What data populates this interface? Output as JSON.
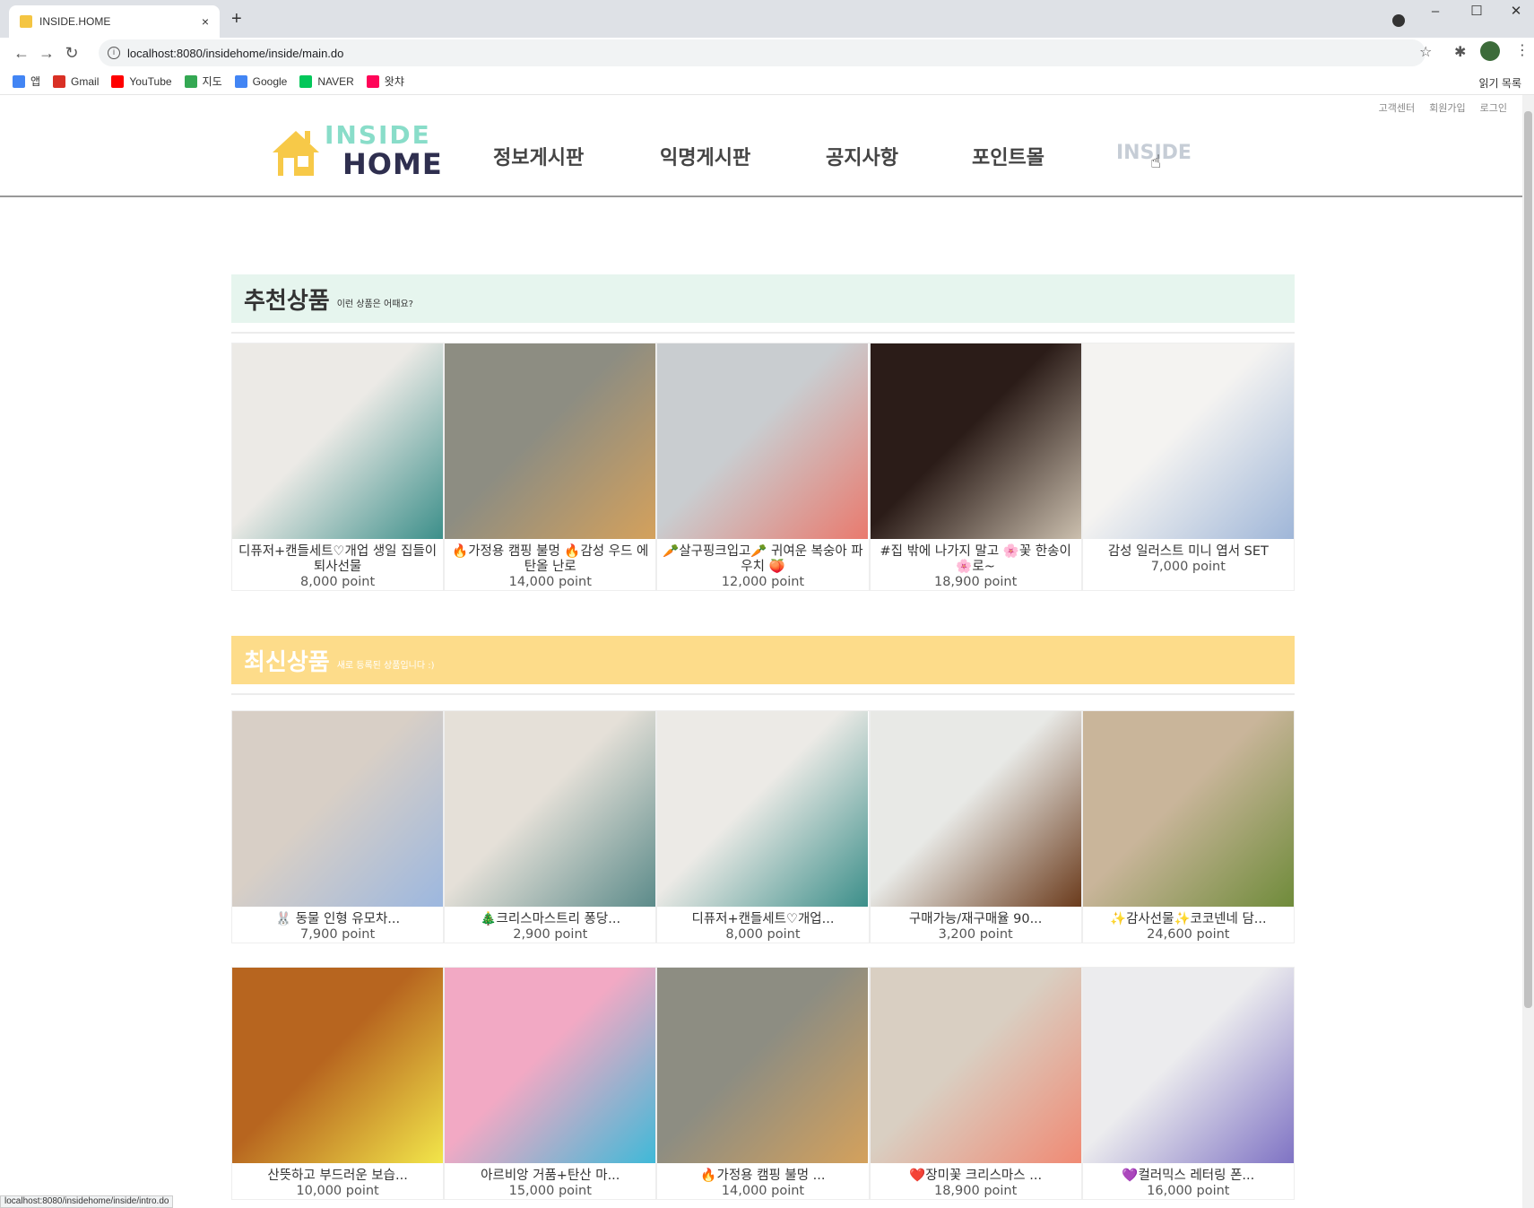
{
  "browser": {
    "tab_title": "INSIDE.HOME",
    "tab_close": "×",
    "new_tab": "+",
    "url": "localhost:8080/insidehome/inside/main.do",
    "window_controls": [
      "–",
      "☐",
      "✕"
    ],
    "bookmarks": [
      {
        "label": "앱",
        "icon": "apps-grid-icon",
        "color": "#4285f4"
      },
      {
        "label": "Gmail",
        "icon": "gmail-icon",
        "color": "#d93025"
      },
      {
        "label": "YouTube",
        "icon": "youtube-icon",
        "color": "#ff0000"
      },
      {
        "label": "지도",
        "icon": "maps-icon",
        "color": "#34a853"
      },
      {
        "label": "Google",
        "icon": "google-icon",
        "color": "#4285f4"
      },
      {
        "label": "NAVER",
        "icon": "naver-icon",
        "color": "#03c75a"
      },
      {
        "label": "왓챠",
        "icon": "watcha-icon",
        "color": "#ff0558"
      }
    ],
    "reading_list": "읽기 목록",
    "status_url": "localhost:8080/insidehome/inside/intro.do"
  },
  "header": {
    "top_links": [
      "고객센터",
      "회원가입",
      "로그인"
    ],
    "logo_line1": "INSIDE",
    "logo_line2": "HOME",
    "menu": [
      "정보게시판",
      "익명게시판",
      "공지사항",
      "포인트몰",
      "INSIDE"
    ]
  },
  "recommended": {
    "title": "추천상품",
    "subtitle": "이런 상품은 어때요?",
    "bar_color": "#e6f5ee",
    "items": [
      {
        "title": "디퓨저+캔들세트♡개업 생일 집들이 퇴사선물",
        "price": "8,000 point",
        "img": "diffuser",
        "c1": "#eceae6",
        "c2": "#3c8f8a"
      },
      {
        "title": "🔥가정용 캠핑 불멍 🔥감성 우드 에탄올 난로",
        "price": "14,000 point",
        "img": "ethanol-burner",
        "c1": "#8d8d82",
        "c2": "#d4a15c"
      },
      {
        "title": "🥕살구핑크입고🥕 귀여운 복숭아 파우치 🍑",
        "price": "12,000 point",
        "img": "peach-pouch",
        "c1": "#c9cdd0",
        "c2": "#e97a6e"
      },
      {
        "title": "#집 밖에 나가지 말고 🌸꽃 한송이🌸로~",
        "price": "18,900 point",
        "img": "flower-bottle",
        "c1": "#2b1c18",
        "c2": "#cbbfae"
      },
      {
        "title": "감성 일러스트 미니 엽서 SET",
        "price": "7,000 point",
        "img": "postcards",
        "c1": "#f4f3f1",
        "c2": "#9fb6d8"
      }
    ]
  },
  "latest": {
    "title": "최신상품",
    "subtitle": "새로 등록된 상품입니다 :)",
    "bar_color": "#fddc8a",
    "items": [
      {
        "title": "🐰 동물 인형 유모차...",
        "price": "7,900 point",
        "img": "animal-dolls",
        "c1": "#d8cfc6",
        "c2": "#9cb7df"
      },
      {
        "title": "🎄크리스마스트리 퐁당...",
        "price": "2,900 point",
        "img": "xmas-candle",
        "c1": "#e5e0d8",
        "c2": "#5c8b8a"
      },
      {
        "title": "디퓨저+캔들세트♡개업...",
        "price": "8,000 point",
        "img": "diffuser",
        "c1": "#eceae6",
        "c2": "#3c8f8a"
      },
      {
        "title": "구매가능/재구매율 90...",
        "price": "3,200 point",
        "img": "amber-bottles",
        "c1": "#e8e9e6",
        "c2": "#6b3b1c"
      },
      {
        "title": "✨감사선물✨코코넨네 담...",
        "price": "24,600 point",
        "img": "blanket",
        "c1": "#c9b59a",
        "c2": "#6f8b3a"
      },
      {
        "title": "산뜻하고 부드러운 보습...",
        "price": "10,000 point",
        "img": "lotion",
        "c1": "#b7651f",
        "c2": "#f2e64a"
      },
      {
        "title": "아르비앙 거품+탄산 마...",
        "price": "15,000 point",
        "img": "bath-bombs",
        "c1": "#f2a9c4",
        "c2": "#3fb9d8"
      },
      {
        "title": "🔥가정용 캠핑 불멍 ...",
        "price": "14,000 point",
        "img": "ethanol-burner",
        "c1": "#8d8d82",
        "c2": "#d4a15c"
      },
      {
        "title": "❤️장미꽃 크리스마스 ...",
        "price": "18,900 point",
        "img": "rose-bear",
        "c1": "#d9cfc2",
        "c2": "#f08a74"
      },
      {
        "title": "💜컬러믹스 레터링 폰...",
        "price": "16,000 point",
        "img": "phone-cases",
        "c1": "#ececee",
        "c2": "#7f73c4"
      }
    ]
  }
}
